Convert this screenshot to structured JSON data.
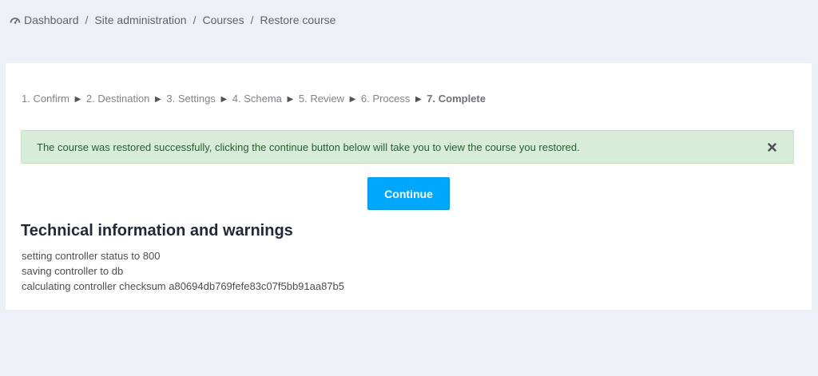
{
  "breadcrumb": {
    "home_icon": "dashboard-gauge-icon",
    "items": [
      "Dashboard",
      "Site administration",
      "Courses",
      "Restore course"
    ],
    "separator": "/"
  },
  "steps": {
    "items": [
      "1. Confirm",
      "2. Destination",
      "3. Settings",
      "4. Schema",
      "5. Review",
      "6. Process",
      "7. Complete"
    ],
    "arrow": "▶",
    "current_index": 6
  },
  "alert": {
    "message": "The course was restored successfully, clicking the continue button below will take you to view the course you restored.",
    "close_icon": "close-icon",
    "color": "#d7edd9"
  },
  "actions": {
    "continue_label": "Continue",
    "accent_color": "#00a7ff"
  },
  "technical": {
    "title": "Technical information and warnings",
    "lines": [
      "setting controller status to 800",
      "saving controller to db",
      "calculating controller checksum a80694db769fefe83c07f5bb91aa87b5"
    ]
  }
}
